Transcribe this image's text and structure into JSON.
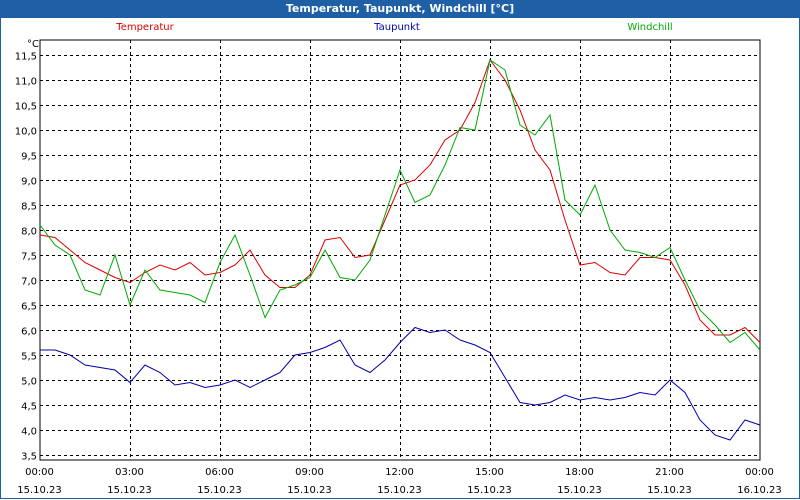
{
  "window": {
    "title": "Temperatur, Taupunkt, Windchill [°C]"
  },
  "chart_data": {
    "type": "line",
    "title": "Temperatur, Taupunkt, Windchill [°C]",
    "ylabel": "°C",
    "ylim": [
      3.4,
      11.8
    ],
    "yticks": [
      "3,5",
      "4,0",
      "4,5",
      "5,0",
      "5,5",
      "6,0",
      "6,5",
      "7,0",
      "7,5",
      "8,0",
      "8,5",
      "9,0",
      "9,5",
      "10,0",
      "10,5",
      "11,0",
      "11,5"
    ],
    "xlim": [
      0,
      24
    ],
    "xticks": [
      {
        "time": "00:00",
        "date": "15.10.23"
      },
      {
        "time": "03:00",
        "date": "15.10.23"
      },
      {
        "time": "06:00",
        "date": "15.10.23"
      },
      {
        "time": "09:00",
        "date": "15.10.23"
      },
      {
        "time": "12:00",
        "date": "15.10.23"
      },
      {
        "time": "15:00",
        "date": "15.10.23"
      },
      {
        "time": "18:00",
        "date": "15.10.23"
      },
      {
        "time": "21:00",
        "date": "15.10.23"
      },
      {
        "time": "00:00",
        "date": "16.10.23"
      }
    ],
    "grid": true,
    "legend": "top",
    "series": [
      {
        "name": "Temperatur",
        "color": "#dd0000",
        "x": [
          0,
          0.5,
          1,
          1.5,
          2,
          2.5,
          3,
          3.5,
          4,
          4.5,
          5,
          5.5,
          6,
          6.5,
          7,
          7.5,
          8,
          8.5,
          9,
          9.5,
          10,
          10.5,
          11,
          11.5,
          12,
          12.5,
          13,
          13.5,
          14,
          14.5,
          15,
          15.5,
          16,
          16.5,
          17,
          17.5,
          18,
          18.5,
          19,
          19.5,
          20,
          20.5,
          21,
          21.5,
          22,
          22.5,
          23,
          23.5,
          24
        ],
        "y": [
          7.9,
          7.85,
          7.6,
          7.35,
          7.2,
          7.05,
          6.95,
          7.15,
          7.3,
          7.2,
          7.35,
          7.1,
          7.15,
          7.3,
          7.6,
          7.1,
          6.85,
          6.85,
          7.1,
          7.8,
          7.85,
          7.45,
          7.5,
          8.2,
          8.9,
          9.0,
          9.3,
          9.8,
          10.0,
          10.55,
          11.4,
          11.0,
          10.4,
          9.6,
          9.2,
          8.2,
          7.3,
          7.35,
          7.15,
          7.1,
          7.45,
          7.45,
          7.4,
          6.9,
          6.2,
          5.9,
          5.9,
          6.05,
          5.75
        ]
      },
      {
        "name": "Taupunkt",
        "color": "#0000aa",
        "x": [
          0,
          0.5,
          1,
          1.5,
          2,
          2.5,
          3,
          3.5,
          4,
          4.5,
          5,
          5.5,
          6,
          6.5,
          7,
          7.5,
          8,
          8.5,
          9,
          9.5,
          10,
          10.5,
          11,
          11.5,
          12,
          12.5,
          13,
          13.5,
          14,
          14.5,
          15,
          15.5,
          16,
          16.5,
          17,
          17.5,
          18,
          18.5,
          19,
          19.5,
          20,
          20.5,
          21,
          21.5,
          22,
          22.5,
          23,
          23.5,
          24
        ],
        "y": [
          5.6,
          5.6,
          5.5,
          5.3,
          5.25,
          5.2,
          4.95,
          5.3,
          5.15,
          4.9,
          4.95,
          4.85,
          4.9,
          5.0,
          4.85,
          5.0,
          5.15,
          5.5,
          5.55,
          5.65,
          5.8,
          5.3,
          5.15,
          5.4,
          5.75,
          6.05,
          5.95,
          6.0,
          5.8,
          5.7,
          5.55,
          5.05,
          4.55,
          4.5,
          4.55,
          4.7,
          4.6,
          4.65,
          4.6,
          4.65,
          4.75,
          4.7,
          5.0,
          4.75,
          4.2,
          3.9,
          3.8,
          4.2,
          4.1
        ]
      },
      {
        "name": "Windchill",
        "color": "#00aa00",
        "x": [
          0,
          0.5,
          1,
          1.5,
          2,
          2.5,
          3,
          3.5,
          4,
          4.5,
          5,
          5.5,
          6,
          6.5,
          7,
          7.5,
          8,
          8.5,
          9,
          9.5,
          10,
          10.5,
          11,
          11.5,
          12,
          12.5,
          13,
          13.5,
          14,
          14.5,
          15,
          15.5,
          16,
          16.5,
          17,
          17.5,
          18,
          18.5,
          19,
          19.5,
          20,
          20.5,
          21,
          21.5,
          22,
          22.5,
          23,
          23.5,
          24
        ],
        "y": [
          8.1,
          7.7,
          7.5,
          6.8,
          6.7,
          7.5,
          6.5,
          7.2,
          6.8,
          6.75,
          6.7,
          6.55,
          7.35,
          7.9,
          7.1,
          6.25,
          6.8,
          6.9,
          7.05,
          7.6,
          7.05,
          7.0,
          7.4,
          8.3,
          9.2,
          8.55,
          8.7,
          9.3,
          10.05,
          10.0,
          11.4,
          11.2,
          10.1,
          9.9,
          10.3,
          8.6,
          8.3,
          8.9,
          8.0,
          7.6,
          7.55,
          7.45,
          7.65,
          7.0,
          6.4,
          6.1,
          5.75,
          5.95,
          5.6
        ]
      }
    ]
  }
}
